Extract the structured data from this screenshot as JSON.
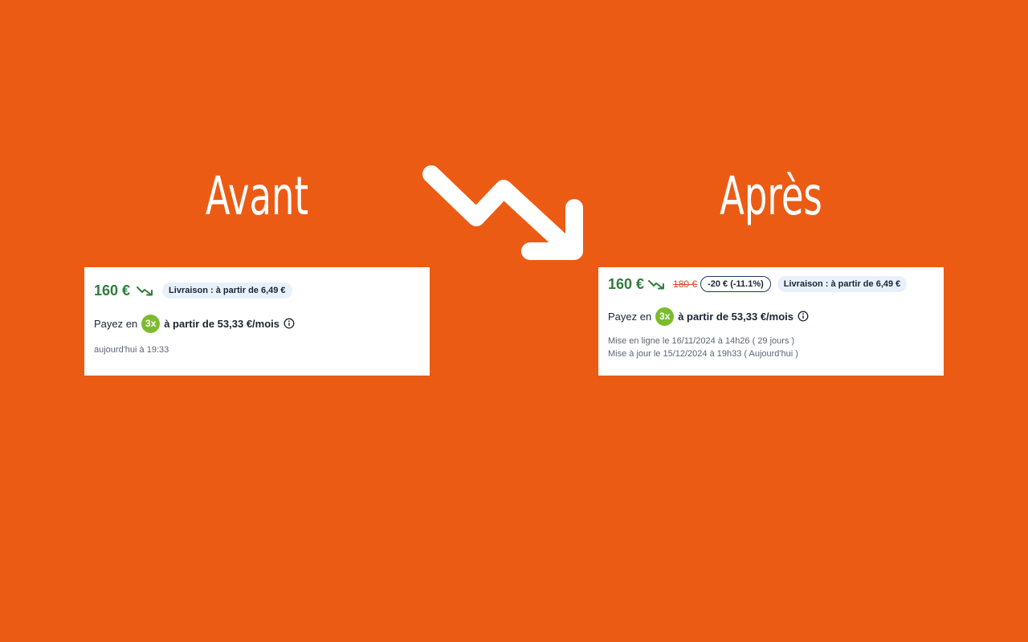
{
  "headings": {
    "before": "Avant",
    "after": "Après"
  },
  "icons": {
    "big_arrow": "trend-down-arrow-icon",
    "price_trend": "trend-down-icon",
    "info": "info-circle-icon"
  },
  "colors": {
    "background": "#ec5b14",
    "price_green": "#2f7d3a",
    "old_price_red": "#d64a36",
    "pay_badge_green": "#7dbb2e",
    "shipping_badge_bg": "#e8f1fb"
  },
  "before_card": {
    "price": "160 €",
    "shipping": "Livraison : à partir de 6,49 €",
    "pay_prefix": "Payez en",
    "pay_badge": "3x",
    "pay_amount": "à partir de 53,33 €/mois",
    "timestamp": "aujourd'hui à 19:33"
  },
  "after_card": {
    "price": "160 €",
    "old_price": "180 €",
    "discount": "-20 € (-11.1%)",
    "shipping": "Livraison : à partir de 6,49 €",
    "pay_prefix": "Payez en",
    "pay_badge": "3x",
    "pay_amount": "à partir de 53,33 €/mois",
    "posted": "Mise en ligne le 16/11/2024 à 14h26 ( 29 jours )",
    "updated": "Mise à jour le 15/12/2024 à 19h33 ( Aujourd'hui )"
  }
}
